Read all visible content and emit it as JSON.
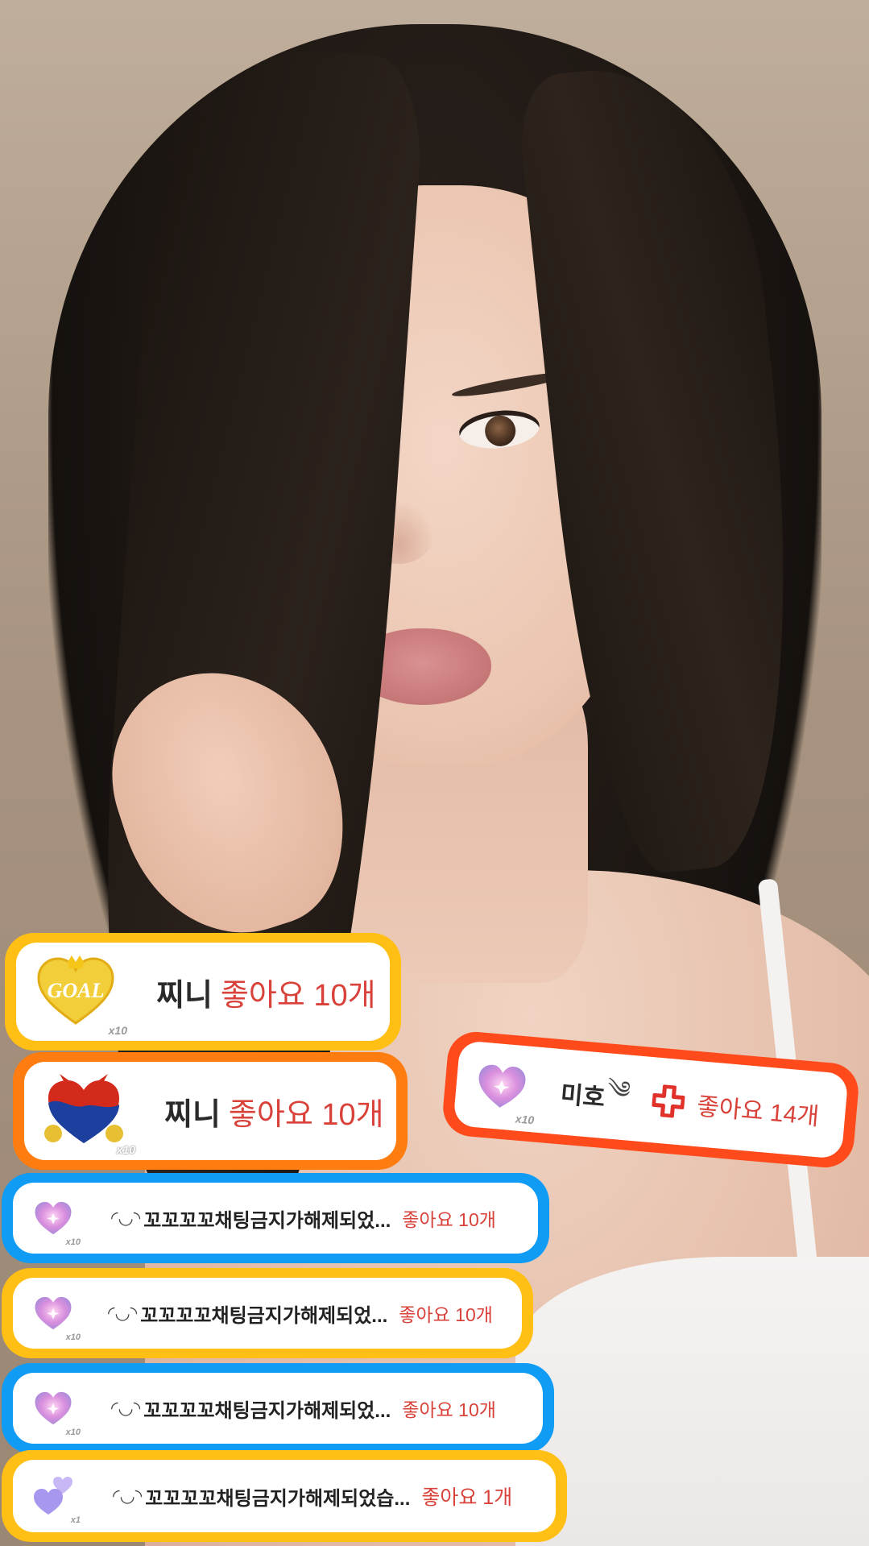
{
  "photo": {
    "subject": "portrait-photo"
  },
  "notifications": [
    {
      "gift": "goal-heart-icon",
      "gift_qty": "x10",
      "name": "찌니",
      "like": "좋아요 10개",
      "border_color": "#ffbf15"
    },
    {
      "gift": "taegeuk-heart-icon",
      "gift_qty": "x10",
      "name": "찌니",
      "like": "좋아요 10개",
      "border_color": "#ff7d10"
    },
    {
      "gift": "purple-heart-icon",
      "gift_qty": "x10",
      "name": "미호",
      "name_deco": "༄",
      "badge": "red-cross-icon",
      "like": "좋아요 14개",
      "border_color": "#ff4b1c"
    },
    {
      "gift": "purple-heart-icon",
      "gift_qty": "x10",
      "emoticon": "◜◡◝",
      "name": "꼬꼬꼬꼬채팅금지가해제되었...",
      "like": "좋아요 10개",
      "border_color": "#109cf5"
    },
    {
      "gift": "purple-heart-icon",
      "gift_qty": "x10",
      "emoticon": "◜◡◝",
      "name": "꼬꼬꼬꼬채팅금지가해제되었...",
      "like": "좋아요 10개",
      "border_color": "#ffbf15"
    },
    {
      "gift": "purple-heart-icon",
      "gift_qty": "x10",
      "emoticon": "◜◡◝",
      "name": "꼬꼬꼬꼬채팅금지가해제되었...",
      "like": "좋아요 10개",
      "border_color": "#109cf5"
    },
    {
      "gift": "lavender-hearts-icon",
      "gift_qty": "x1",
      "emoticon": "◜◡◝",
      "name": "꼬꼬꼬꼬채팅금지가해제되었습...",
      "like": "좋아요 1개",
      "border_color": "#ffbf15"
    }
  ],
  "gift_labels": {
    "goal": "GOAL"
  }
}
